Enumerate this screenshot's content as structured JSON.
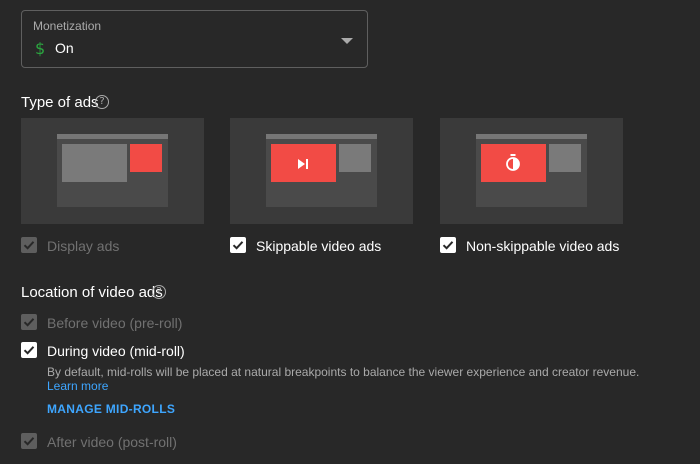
{
  "monetization": {
    "label": "Monetization",
    "value": "On",
    "icon": "dollar-icon",
    "icon_glyph": "$"
  },
  "type_of_ads": {
    "title": "Type of ads",
    "help_glyph": "?",
    "items": [
      {
        "label": "Display ads",
        "checked": true,
        "disabled": true
      },
      {
        "label": "Skippable video ads",
        "checked": true,
        "disabled": false,
        "icon": "skip-next-icon"
      },
      {
        "label": "Non-skippable video ads",
        "checked": true,
        "disabled": false,
        "icon": "stopwatch-icon"
      }
    ]
  },
  "location": {
    "title": "Location of video ads",
    "help_glyph": "?",
    "pre_roll": {
      "label": "Before video (pre-roll)",
      "checked": true,
      "disabled": true
    },
    "mid_roll": {
      "label": "During video (mid-roll)",
      "checked": true,
      "disabled": false,
      "description": "By default, mid-rolls will be placed at natural breakpoints to balance the viewer experience and creator revenue.",
      "learn_more": "Learn more",
      "manage": "MANAGE MID-ROLLS"
    },
    "post_roll": {
      "label": "After video (post-roll)",
      "checked": true,
      "disabled": true
    }
  },
  "colors": {
    "background": "#282828",
    "accent_red": "#f24b45",
    "link_blue": "#3ea6ff",
    "money_green": "#2ba640"
  }
}
